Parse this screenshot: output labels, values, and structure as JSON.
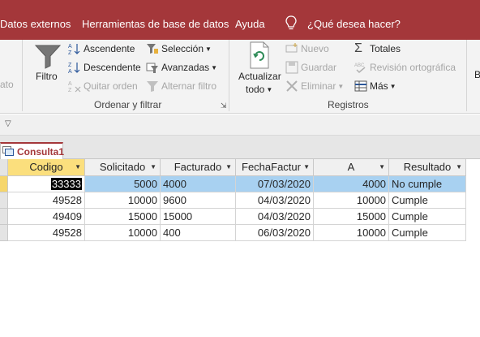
{
  "menu": {
    "items": [
      "Datos externos",
      "Herramientas de base de datos",
      "Ayuda"
    ],
    "search_prompt": "¿Qué desea hacer?"
  },
  "ribbon": {
    "left_partial": "ato",
    "sort_filter": {
      "filter_label": "Filtro",
      "ascending": "Ascendente",
      "descending": "Descendente",
      "remove_sort": "Quitar orden",
      "selection": "Selección",
      "advanced": "Avanzadas",
      "toggle_filter": "Alternar filtro",
      "group_label": "Ordenar y filtrar"
    },
    "records": {
      "refresh_line1": "Actualizar",
      "refresh_line2": "todo",
      "new": "Nuevo",
      "save": "Guardar",
      "delete": "Eliminar",
      "totals": "Totales",
      "spelling": "Revisión ortográfica",
      "more": "Más",
      "group_label": "Registros"
    },
    "right_partial": "B"
  },
  "tab": {
    "label": "Consulta1"
  },
  "table": {
    "columns": [
      "Codigo",
      "Solicitado",
      "Facturado",
      "FechaFactur",
      "A",
      "Resultado"
    ],
    "rows": [
      [
        "33333",
        "5000",
        "4000",
        "07/03/2020",
        "4000",
        "No cumple"
      ],
      [
        "49528",
        "10000",
        "9600",
        "04/03/2020",
        "10000",
        "Cumple"
      ],
      [
        "49409",
        "15000",
        "15000",
        "04/03/2020",
        "15000",
        "Cumple"
      ],
      [
        "49528",
        "10000",
        "400",
        "06/03/2020",
        "10000",
        "Cumple"
      ]
    ]
  },
  "colors": {
    "brand": "#a4373a",
    "selected_row": "#a8d1f1",
    "selected_header": "#fbdf7d"
  }
}
